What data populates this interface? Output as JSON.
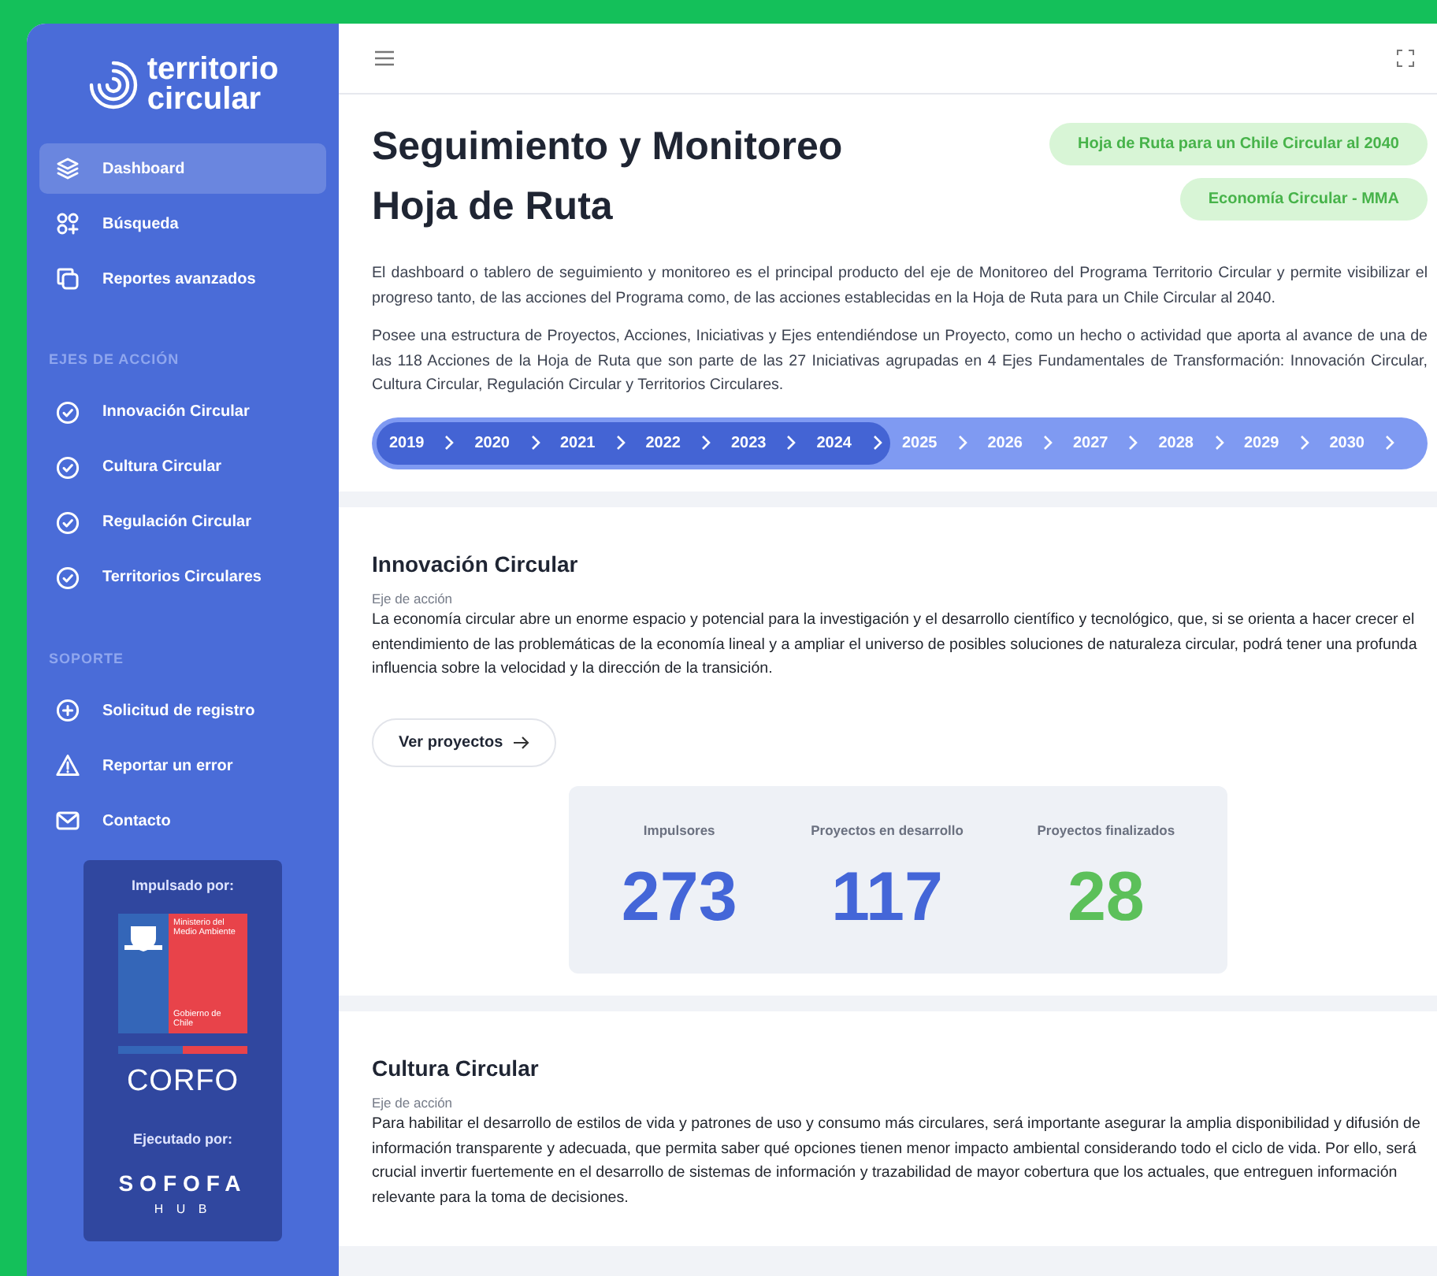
{
  "sidebar": {
    "logo": [
      "territorio",
      "circular"
    ],
    "nav": [
      {
        "label": "Dashboard",
        "kind": "layers",
        "selected": true
      },
      {
        "label": "Búsqueda",
        "kind": "grid",
        "selected": false
      },
      {
        "label": "Reportes avanzados",
        "kind": "copy",
        "selected": false
      }
    ],
    "sections": [
      {
        "heading": "EJES DE ACCIÓN",
        "items": [
          {
            "label": "Innovación Circular",
            "kind": "check"
          },
          {
            "label": "Cultura Circular",
            "kind": "check"
          },
          {
            "label": "Regulación Circular",
            "kind": "check"
          },
          {
            "label": "Territorios Circulares",
            "kind": "check"
          }
        ]
      },
      {
        "heading": "SOPORTE",
        "items": [
          {
            "label": "Solicitud de registro",
            "kind": "plus"
          },
          {
            "label": "Reportar un error",
            "kind": "warning"
          },
          {
            "label": "Contacto",
            "kind": "mail"
          }
        ]
      }
    ],
    "sponsors": {
      "promoted_by": "Impulsado por:",
      "ministry": "Ministerio del Medio Ambiente",
      "government": "Gobierno de Chile",
      "corfo": "CORFO",
      "executed_by": "Ejecutado por:",
      "sofofa": "SOFOFA",
      "hub": "H U B"
    }
  },
  "header": {
    "title": [
      "Seguimiento y Monitoreo",
      "Hoja de Ruta"
    ],
    "tags": [
      "Hoja de Ruta para un Chile Circular al 2040",
      "Economía Circular - MMA"
    ],
    "paragraphs": [
      "El dashboard o tablero de seguimiento y monitoreo es el principal producto del eje de Monitoreo del Programa Territorio Circular y permite visibilizar el progreso tanto, de las acciones del Programa como, de las acciones establecidas en la Hoja de Ruta para un Chile Circular al 2040.",
      "Posee una estructura de Proyectos, Acciones, Iniciativas y Ejes entendiéndose un Proyecto, como un hecho o actividad que aporta al avance de una de las 118 Acciones de la Hoja de Ruta que son parte de las 27 Iniciativas agrupadas en 4 Ejes Fundamentales de Transformación: Innovación Circular, Cultura Circular, Regulación Circular y Territorios Circulares."
    ],
    "timeline": [
      {
        "year": "2019",
        "reached": true
      },
      {
        "year": "2020",
        "reached": true
      },
      {
        "year": "2021",
        "reached": true
      },
      {
        "year": "2022",
        "reached": true
      },
      {
        "year": "2023",
        "reached": true
      },
      {
        "year": "2024",
        "reached": true
      },
      {
        "year": "2025",
        "reached": false
      },
      {
        "year": "2026",
        "reached": false
      },
      {
        "year": "2027",
        "reached": false
      },
      {
        "year": "2028",
        "reached": false
      },
      {
        "year": "2029",
        "reached": false
      },
      {
        "year": "2030",
        "reached": false
      }
    ]
  },
  "axes": [
    {
      "title": "Innovación Circular",
      "subtitle": "Eje de acción",
      "text": "La economía circular abre un enorme espacio y potencial para la investigación y el desarrollo científico y tecnológico, que, si se orienta a hacer crecer el entendimiento de las problemáticas de la economía lineal y a ampliar el universo de posibles soluciones de naturaleza circular, podrá tener una profunda influencia sobre la velocidad y la dirección de la transición.",
      "button": "Ver proyectos",
      "stats": [
        {
          "label": "Impulsores",
          "value": "273",
          "color": "#4466d8"
        },
        {
          "label": "Proyectos en desarrollo",
          "value": "117",
          "color": "#4466d8"
        },
        {
          "label": "Proyectos finalizados",
          "value": "28",
          "color": "#5cc05a"
        }
      ]
    },
    {
      "title": "Cultura Circular",
      "subtitle": "Eje de acción",
      "text": "Para habilitar el desarrollo de estilos de vida y patrones de uso y consumo más circulares, será importante asegurar la amplia disponibilidad y difusión de información transparente y adecuada, que permita saber qué opciones tienen menor impacto ambiental considerando todo el ciclo de vida. Por ello, será crucial invertir fuertemente en el desarrollo de sistemas de información y trazabilidad de mayor cobertura que los actuales, que entreguen información relevante para la toma de decisiones."
    }
  ]
}
